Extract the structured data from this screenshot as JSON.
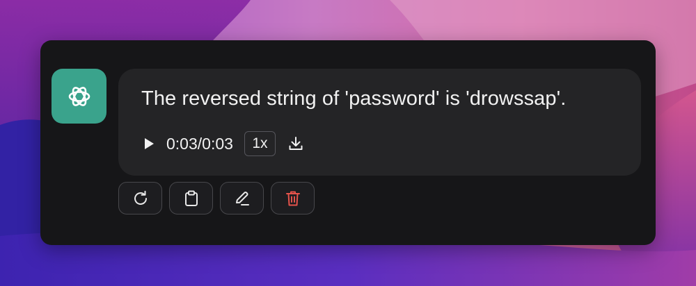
{
  "message": {
    "text": "The reversed string of 'password' is 'drowssap'."
  },
  "audio": {
    "time": "0:03/0:03",
    "speed": "1x"
  },
  "avatar": {
    "icon": "openai-logo-icon",
    "background": "#3aa38c"
  },
  "actions": [
    {
      "name": "regenerate",
      "icon": "refresh-icon"
    },
    {
      "name": "copy",
      "icon": "clipboard-icon"
    },
    {
      "name": "edit",
      "icon": "pencil-icon"
    },
    {
      "name": "delete",
      "icon": "trash-icon",
      "color": "#e5534b"
    }
  ]
}
